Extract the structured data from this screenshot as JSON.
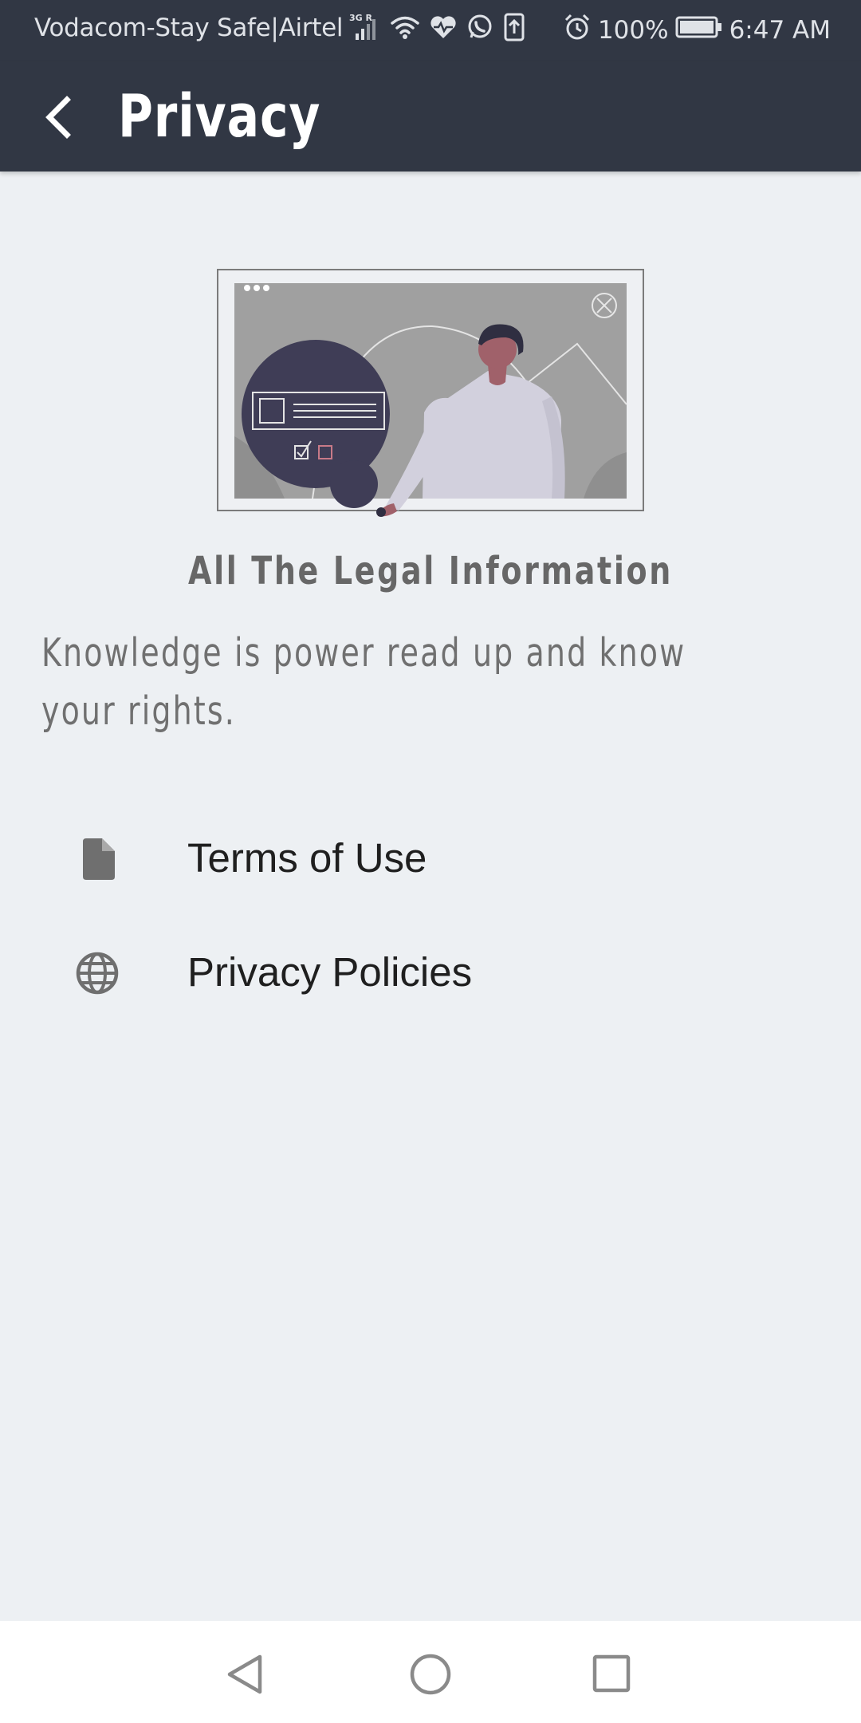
{
  "status_bar": {
    "carrier": "Vodacom-Stay Safe|Airtel",
    "network_type": "3G R",
    "battery_percent": "100%",
    "time": "6:47 AM",
    "icons": [
      "signal-icon",
      "wifi-icon",
      "health-icon",
      "whatsapp-icon",
      "upload-icon",
      "alarm-icon",
      "battery-icon"
    ]
  },
  "app_bar": {
    "title": "Privacy",
    "back_icon": "back-arrow-icon"
  },
  "content": {
    "heading": "All The Legal Information",
    "subtext": "Knowledge is power read up and know your rights.",
    "items": [
      {
        "label": "Terms of Use",
        "icon": "document-icon"
      },
      {
        "label": "Privacy Policies",
        "icon": "globe-icon"
      }
    ]
  },
  "nav_bar": {
    "icons": [
      "back-triangle-icon",
      "home-circle-icon",
      "recents-square-icon"
    ]
  },
  "colors": {
    "app_bar": "#313744",
    "background": "#edf0f3",
    "heading_text": "#676767",
    "item_text": "#1f1f1f",
    "icon_gray": "#6f6f6f"
  }
}
